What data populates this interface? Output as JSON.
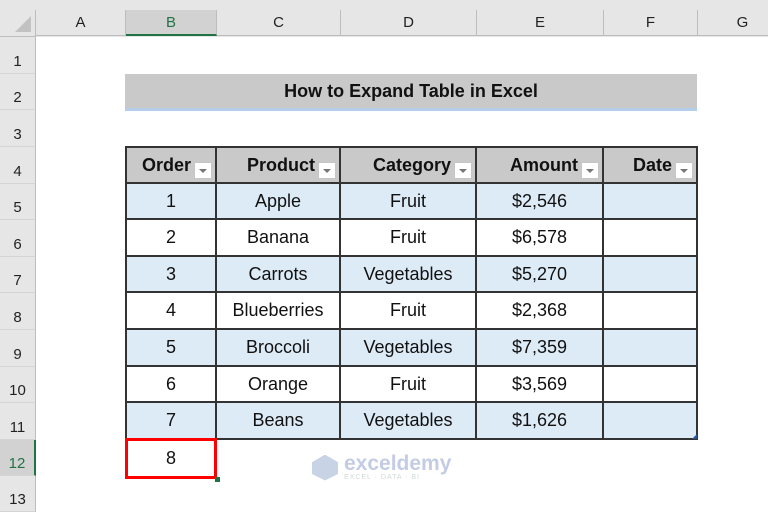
{
  "spreadsheet": {
    "columns": [
      "A",
      "B",
      "C",
      "D",
      "E",
      "F",
      "G"
    ],
    "selected_column": "B",
    "rows": [
      "1",
      "2",
      "3",
      "4",
      "5",
      "6",
      "7",
      "8",
      "9",
      "10",
      "11",
      "12",
      "13"
    ],
    "selected_row": "12"
  },
  "title": "How to Expand Table in Excel",
  "table": {
    "headers": [
      "Order",
      "Product",
      "Category",
      "Amount",
      "Date"
    ],
    "rows": [
      [
        "1",
        "Apple",
        "Fruit",
        "$2,546",
        ""
      ],
      [
        "2",
        "Banana",
        "Fruit",
        "$6,578",
        ""
      ],
      [
        "3",
        "Carrots",
        "Vegetables",
        "$5,270",
        ""
      ],
      [
        "4",
        "Blueberries",
        "Fruit",
        "$2,368",
        ""
      ],
      [
        "5",
        "Broccoli",
        "Vegetables",
        "$7,359",
        ""
      ],
      [
        "6",
        "Orange",
        "Fruit",
        "$3,569",
        ""
      ],
      [
        "7",
        "Beans",
        "Vegetables",
        "$1,626",
        ""
      ]
    ],
    "new_entry": "8"
  },
  "colors": {
    "header_fill": "#c9c9c9",
    "band_fill": "#ddebf7",
    "highlight": "#ff0000",
    "excel_green": "#217346"
  },
  "watermark": {
    "name": "exceldemy",
    "tagline": "EXCEL · DATA · BI"
  }
}
